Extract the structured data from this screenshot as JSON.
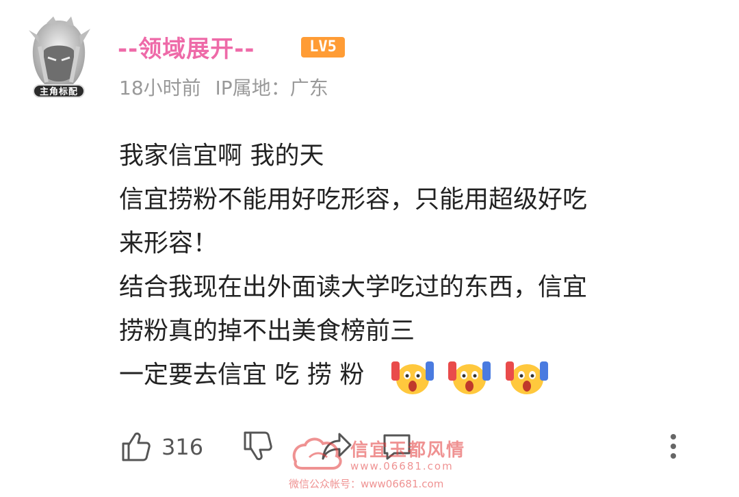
{
  "user": {
    "name": "--领域展开--",
    "level": "LV5",
    "avatar_tag": "主角标配",
    "time": "18小时前",
    "ip_label": "IP属地：广东"
  },
  "comment": {
    "lines": [
      "我家信宜啊  我的天",
      "信宜捞粉不能用好吃形容，只能用超级好吃",
      "来形容！",
      "结合我现在出外面读大学吃过的东西，信宜",
      "捞粉真的掉不出美食榜前三",
      "一定要去信宜 吃 捞 粉"
    ],
    "emoji_count": 3
  },
  "actions": {
    "like_count": "316"
  },
  "watermark": {
    "title": "信宜玉都风情",
    "url": "www.06681.com",
    "sub": "微信公众帐号：www06681.com"
  },
  "colors": {
    "username": "#ee6aa8",
    "level_badge": "#ff9c35",
    "meta": "#999999"
  }
}
